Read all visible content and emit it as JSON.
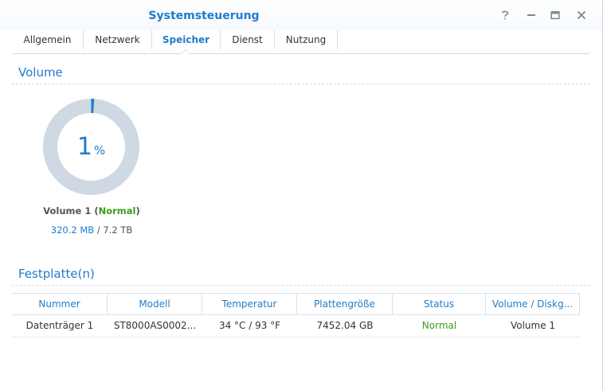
{
  "window": {
    "title": "Systemsteuerung",
    "controls": [
      "help-icon",
      "minimize-icon",
      "maximize-icon",
      "close-icon"
    ]
  },
  "tabs": [
    {
      "label": "Allgemein",
      "active": false
    },
    {
      "label": "Netzwerk",
      "active": false
    },
    {
      "label": "Speicher",
      "active": true
    },
    {
      "label": "Dienst",
      "active": false
    },
    {
      "label": "Nutzung",
      "active": false
    }
  ],
  "volume_section": {
    "title": "Volume",
    "usage_percent": 1,
    "percent_sign": "%",
    "volume_name": "Volume 1",
    "status": "Normal",
    "used": "320.2 MB",
    "total": "7.2 TB",
    "colors": {
      "ring": "#cfd9e3",
      "used": "#1f7ccc",
      "status": "#3c9a1e"
    }
  },
  "disk_section": {
    "title": "Festplatte(n)",
    "columns": [
      "Nummer",
      "Modell",
      "Temperatur",
      "Plattengröße",
      "Status",
      "Volume / Diskg..."
    ],
    "rows": [
      [
        "Datenträger 1",
        "ST8000AS0002...",
        "34 °C / 93 °F",
        "7452.04 GB",
        "Normal",
        "Volume 1"
      ]
    ]
  }
}
